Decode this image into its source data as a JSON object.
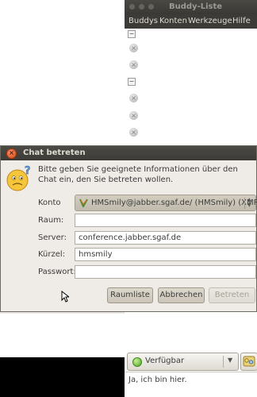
{
  "buddy_window": {
    "title": "Buddy-Liste",
    "menu": [
      "Buddys",
      "Konten",
      "Werkzeuge",
      "Hilfe"
    ],
    "status": {
      "selected": "Verfügbar",
      "color": "#4fa420"
    },
    "status_message": "Ja, ich bin hier."
  },
  "chat_dialog": {
    "title": "Chat betreten",
    "instructions": "Bitte geben Sie geeignete Informationen über den Chat ein, den Sie betreten wollen.",
    "labels": {
      "account": "Konto",
      "room": "Raum:",
      "server": "Server:",
      "handle": "Kürzel:",
      "password": "Passwort:"
    },
    "values": {
      "account": "HMSmily@jabber.sgaf.de/ (HMSmily) (XMPP)",
      "room": "",
      "server": "conference.jabber.sgaf.de",
      "handle": "hmsmily",
      "password": ""
    },
    "buttons": {
      "room_list": "Raumliste",
      "cancel": "Abbrechen",
      "join": "Betreten"
    }
  },
  "icons": {
    "close": "close-icon",
    "emoticon": "confused-smiley-icon",
    "account": "xmpp-protocol-icon",
    "status": "available-status-icon",
    "buddy_icon": "buddy-avatar-icon"
  },
  "colors": {
    "titlebar": "#3c3b37",
    "dialog_bg": "#efebe7",
    "close_button": "#d9480f",
    "status_available": "#4fa420"
  }
}
